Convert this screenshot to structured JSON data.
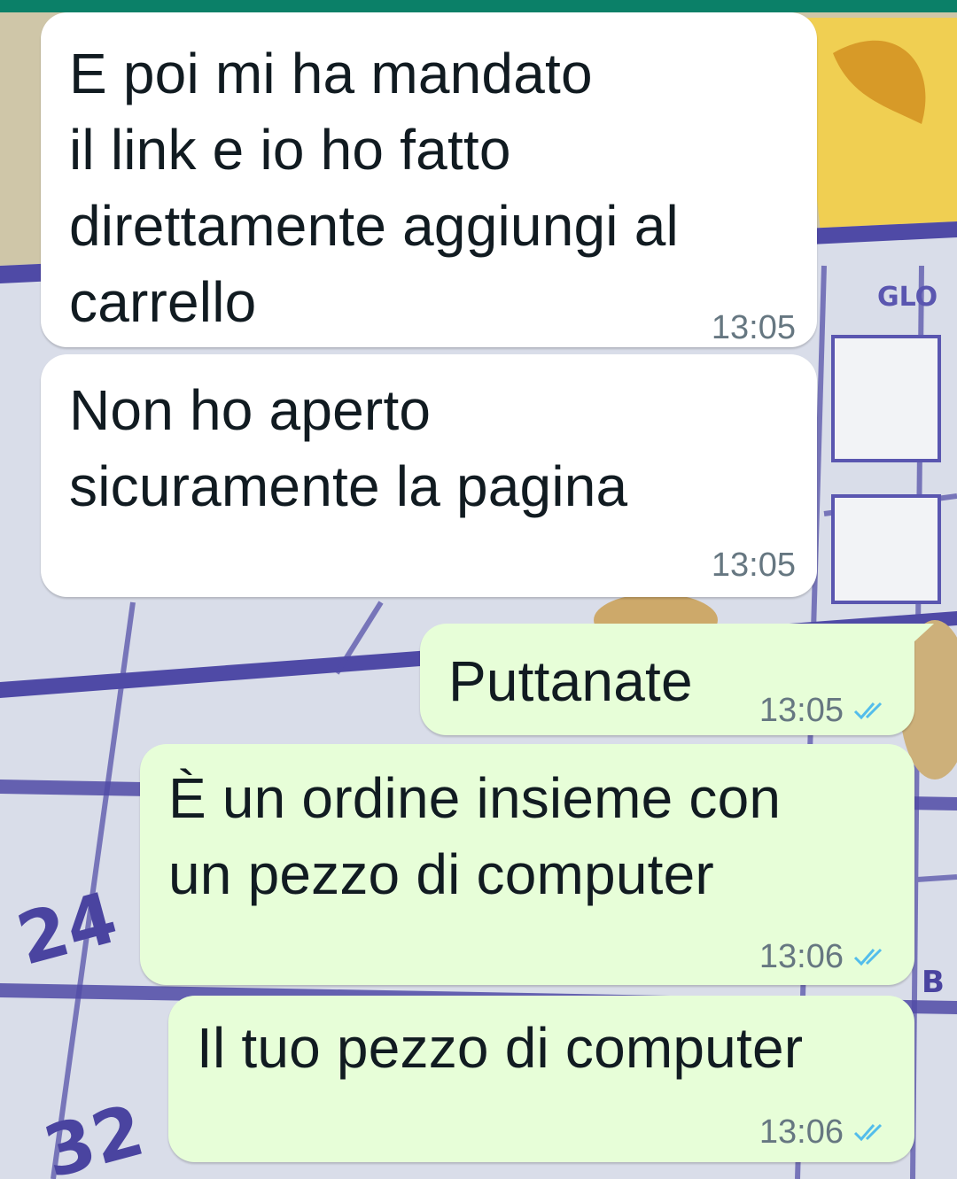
{
  "theme": {
    "header_color": "#0b8068",
    "incoming_bubble": "#ffffff",
    "outgoing_bubble": "#e7fed8",
    "read_ticks": "#53bdeb",
    "timestamp_color": "#667781"
  },
  "wallpaper": {
    "description_icon": "photo-wallpaper",
    "visible_texts": [
      "GLO",
      "24",
      "32",
      "B"
    ]
  },
  "chat": {
    "messages": [
      {
        "direction": "incoming",
        "text": "E poi mi ha mandato\nil link e io ho fatto\ndirettamente aggiungi al\ncarrello",
        "time": "13:05"
      },
      {
        "direction": "incoming",
        "text": "Non ho aperto\nsicuramente la pagina",
        "time": "13:05"
      },
      {
        "direction": "outgoing",
        "text": "Puttanate",
        "time": "13:05",
        "status_icon": "read-double-check-icon"
      },
      {
        "direction": "outgoing",
        "text": "È un ordine insieme con\nun pezzo di computer",
        "time": "13:06",
        "status_icon": "read-double-check-icon"
      },
      {
        "direction": "outgoing",
        "text": "Il tuo pezzo di computer",
        "time": "13:06",
        "status_icon": "read-double-check-icon"
      }
    ]
  }
}
